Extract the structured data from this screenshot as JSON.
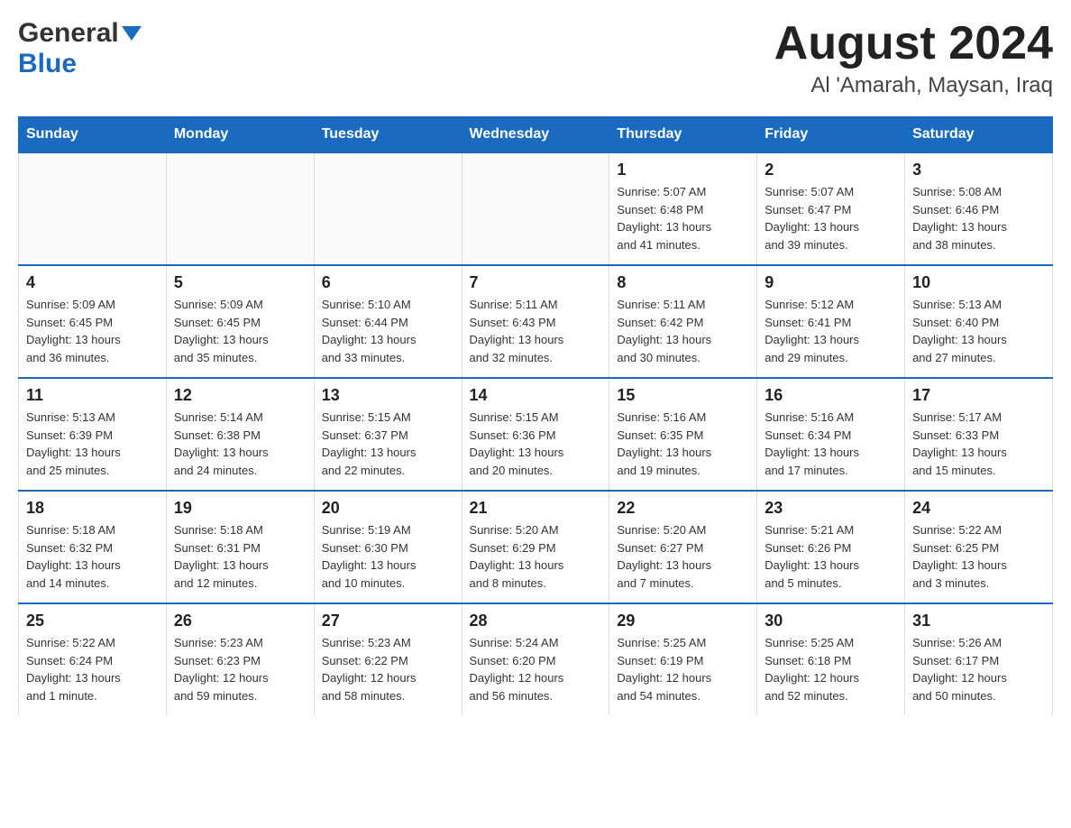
{
  "header": {
    "logo": {
      "general_text": "General",
      "blue_text": "Blue"
    },
    "month_title": "August 2024",
    "location": "Al 'Amarah, Maysan, Iraq"
  },
  "calendar": {
    "days_of_week": [
      "Sunday",
      "Monday",
      "Tuesday",
      "Wednesday",
      "Thursday",
      "Friday",
      "Saturday"
    ],
    "weeks": [
      {
        "days": [
          {
            "number": "",
            "info": ""
          },
          {
            "number": "",
            "info": ""
          },
          {
            "number": "",
            "info": ""
          },
          {
            "number": "",
            "info": ""
          },
          {
            "number": "1",
            "info": "Sunrise: 5:07 AM\nSunset: 6:48 PM\nDaylight: 13 hours\nand 41 minutes."
          },
          {
            "number": "2",
            "info": "Sunrise: 5:07 AM\nSunset: 6:47 PM\nDaylight: 13 hours\nand 39 minutes."
          },
          {
            "number": "3",
            "info": "Sunrise: 5:08 AM\nSunset: 6:46 PM\nDaylight: 13 hours\nand 38 minutes."
          }
        ]
      },
      {
        "days": [
          {
            "number": "4",
            "info": "Sunrise: 5:09 AM\nSunset: 6:45 PM\nDaylight: 13 hours\nand 36 minutes."
          },
          {
            "number": "5",
            "info": "Sunrise: 5:09 AM\nSunset: 6:45 PM\nDaylight: 13 hours\nand 35 minutes."
          },
          {
            "number": "6",
            "info": "Sunrise: 5:10 AM\nSunset: 6:44 PM\nDaylight: 13 hours\nand 33 minutes."
          },
          {
            "number": "7",
            "info": "Sunrise: 5:11 AM\nSunset: 6:43 PM\nDaylight: 13 hours\nand 32 minutes."
          },
          {
            "number": "8",
            "info": "Sunrise: 5:11 AM\nSunset: 6:42 PM\nDaylight: 13 hours\nand 30 minutes."
          },
          {
            "number": "9",
            "info": "Sunrise: 5:12 AM\nSunset: 6:41 PM\nDaylight: 13 hours\nand 29 minutes."
          },
          {
            "number": "10",
            "info": "Sunrise: 5:13 AM\nSunset: 6:40 PM\nDaylight: 13 hours\nand 27 minutes."
          }
        ]
      },
      {
        "days": [
          {
            "number": "11",
            "info": "Sunrise: 5:13 AM\nSunset: 6:39 PM\nDaylight: 13 hours\nand 25 minutes."
          },
          {
            "number": "12",
            "info": "Sunrise: 5:14 AM\nSunset: 6:38 PM\nDaylight: 13 hours\nand 24 minutes."
          },
          {
            "number": "13",
            "info": "Sunrise: 5:15 AM\nSunset: 6:37 PM\nDaylight: 13 hours\nand 22 minutes."
          },
          {
            "number": "14",
            "info": "Sunrise: 5:15 AM\nSunset: 6:36 PM\nDaylight: 13 hours\nand 20 minutes."
          },
          {
            "number": "15",
            "info": "Sunrise: 5:16 AM\nSunset: 6:35 PM\nDaylight: 13 hours\nand 19 minutes."
          },
          {
            "number": "16",
            "info": "Sunrise: 5:16 AM\nSunset: 6:34 PM\nDaylight: 13 hours\nand 17 minutes."
          },
          {
            "number": "17",
            "info": "Sunrise: 5:17 AM\nSunset: 6:33 PM\nDaylight: 13 hours\nand 15 minutes."
          }
        ]
      },
      {
        "days": [
          {
            "number": "18",
            "info": "Sunrise: 5:18 AM\nSunset: 6:32 PM\nDaylight: 13 hours\nand 14 minutes."
          },
          {
            "number": "19",
            "info": "Sunrise: 5:18 AM\nSunset: 6:31 PM\nDaylight: 13 hours\nand 12 minutes."
          },
          {
            "number": "20",
            "info": "Sunrise: 5:19 AM\nSunset: 6:30 PM\nDaylight: 13 hours\nand 10 minutes."
          },
          {
            "number": "21",
            "info": "Sunrise: 5:20 AM\nSunset: 6:29 PM\nDaylight: 13 hours\nand 8 minutes."
          },
          {
            "number": "22",
            "info": "Sunrise: 5:20 AM\nSunset: 6:27 PM\nDaylight: 13 hours\nand 7 minutes."
          },
          {
            "number": "23",
            "info": "Sunrise: 5:21 AM\nSunset: 6:26 PM\nDaylight: 13 hours\nand 5 minutes."
          },
          {
            "number": "24",
            "info": "Sunrise: 5:22 AM\nSunset: 6:25 PM\nDaylight: 13 hours\nand 3 minutes."
          }
        ]
      },
      {
        "days": [
          {
            "number": "25",
            "info": "Sunrise: 5:22 AM\nSunset: 6:24 PM\nDaylight: 13 hours\nand 1 minute."
          },
          {
            "number": "26",
            "info": "Sunrise: 5:23 AM\nSunset: 6:23 PM\nDaylight: 12 hours\nand 59 minutes."
          },
          {
            "number": "27",
            "info": "Sunrise: 5:23 AM\nSunset: 6:22 PM\nDaylight: 12 hours\nand 58 minutes."
          },
          {
            "number": "28",
            "info": "Sunrise: 5:24 AM\nSunset: 6:20 PM\nDaylight: 12 hours\nand 56 minutes."
          },
          {
            "number": "29",
            "info": "Sunrise: 5:25 AM\nSunset: 6:19 PM\nDaylight: 12 hours\nand 54 minutes."
          },
          {
            "number": "30",
            "info": "Sunrise: 5:25 AM\nSunset: 6:18 PM\nDaylight: 12 hours\nand 52 minutes."
          },
          {
            "number": "31",
            "info": "Sunrise: 5:26 AM\nSunset: 6:17 PM\nDaylight: 12 hours\nand 50 minutes."
          }
        ]
      }
    ]
  }
}
